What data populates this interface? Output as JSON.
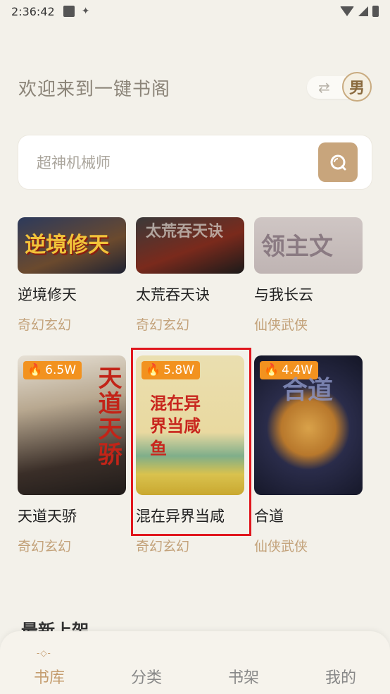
{
  "status_bar": {
    "time": "2:36:42"
  },
  "header": {
    "welcome": "欢迎来到一键书阁",
    "gender": "男"
  },
  "search": {
    "placeholder": "超神机械师"
  },
  "books": [
    {
      "title": "逆境修天",
      "genre": "奇幻玄幻",
      "cover_text": "逆境修天"
    },
    {
      "title": "太荒吞天诀",
      "genre": "奇幻玄幻",
      "cover_text": "太荒吞天诀"
    },
    {
      "title": "与我长云",
      "genre": "仙侠武侠",
      "cover_text": "领主文"
    },
    {
      "title": "天道天骄",
      "genre": "奇幻玄幻",
      "hot": "6.5W",
      "cover_text": "天道天骄"
    },
    {
      "title": "混在异界当咸",
      "genre": "奇幻玄幻",
      "hot": "5.8W",
      "cover_text": "混在异界当咸鱼"
    },
    {
      "title": "合道",
      "genre": "仙侠武侠",
      "hot": "4.4W",
      "cover_text": "合道"
    }
  ],
  "section_peek": "最新上架",
  "tabs": [
    {
      "label": "书库"
    },
    {
      "label": "分类"
    },
    {
      "label": "书架"
    },
    {
      "label": "我的"
    }
  ]
}
